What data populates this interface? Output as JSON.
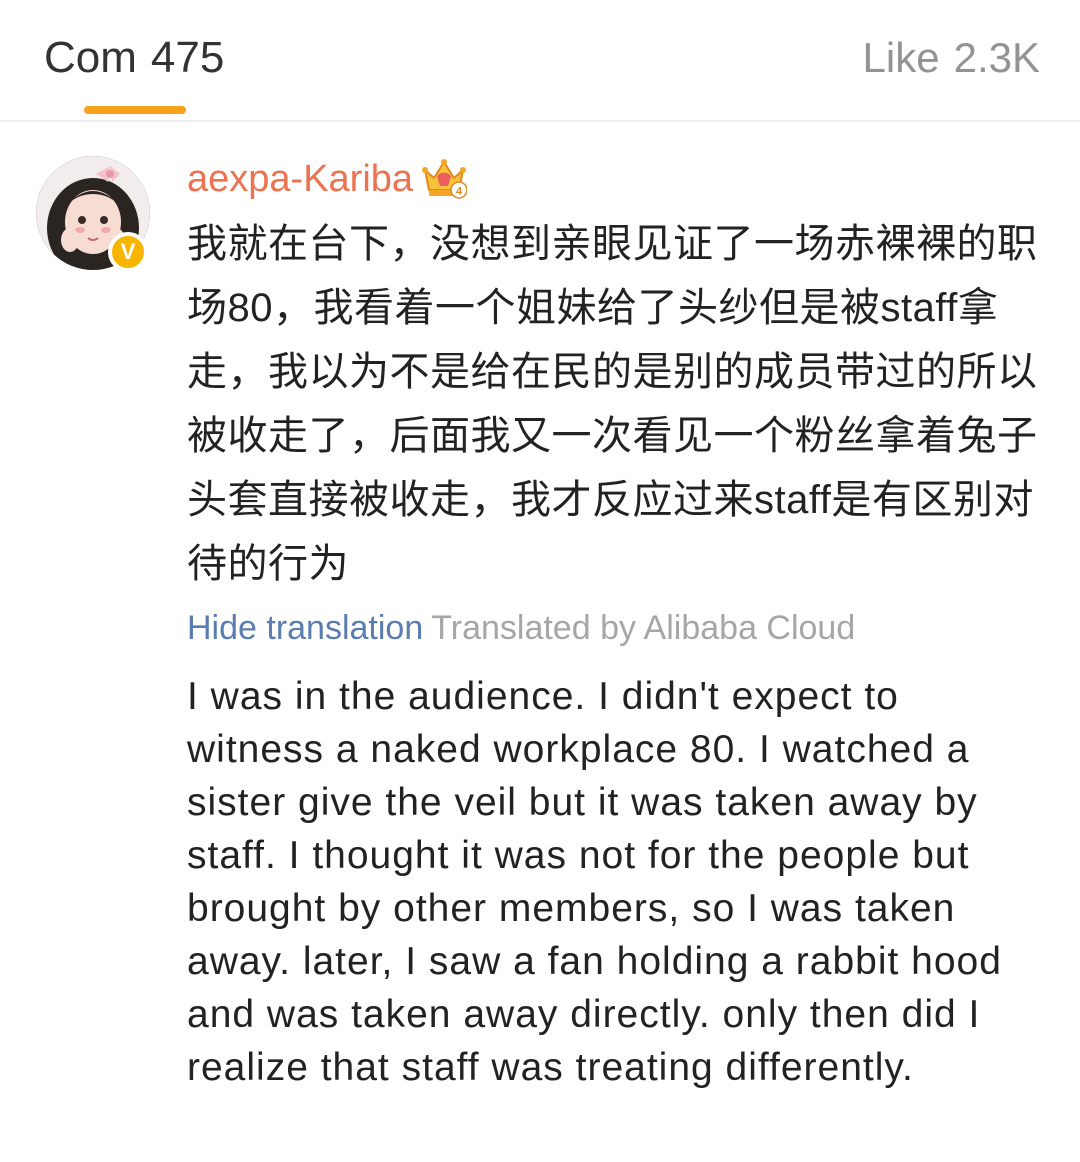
{
  "tabs": {
    "comments": {
      "label": "Com",
      "count": "475"
    },
    "likes": {
      "label": "Like",
      "count": "2.3K"
    },
    "accent_color": "#f7a21b"
  },
  "comment": {
    "username": "aexpa-Kariba",
    "username_color": "#eb7350",
    "verified_icon": "verified-v-icon",
    "vip_icon": "vip-crown-icon",
    "vip_level": "4",
    "original_text": "我就在台下，没想到亲眼见证了一场赤裸裸的职场80，我看着一个姐妹给了头纱但是被staff拿走，我以为不是给在民的是别的成员带过的所以被收走了，后面我又一次看见一个粉丝拿着兔子头套直接被收走，我才反应过来staff是有区别对待的行为",
    "hide_translation_label": "Hide translation",
    "translated_by": "Translated by Alibaba Cloud",
    "translated_text": "I was in the audience. I didn't expect to witness a naked workplace 80. I watched a sister give the veil but it was taken away by staff. I thought it was not for the people but brought by other members, so I was taken away. later, I saw a fan holding a rabbit hood and was taken away directly. only then did I realize that staff was treating differently."
  }
}
